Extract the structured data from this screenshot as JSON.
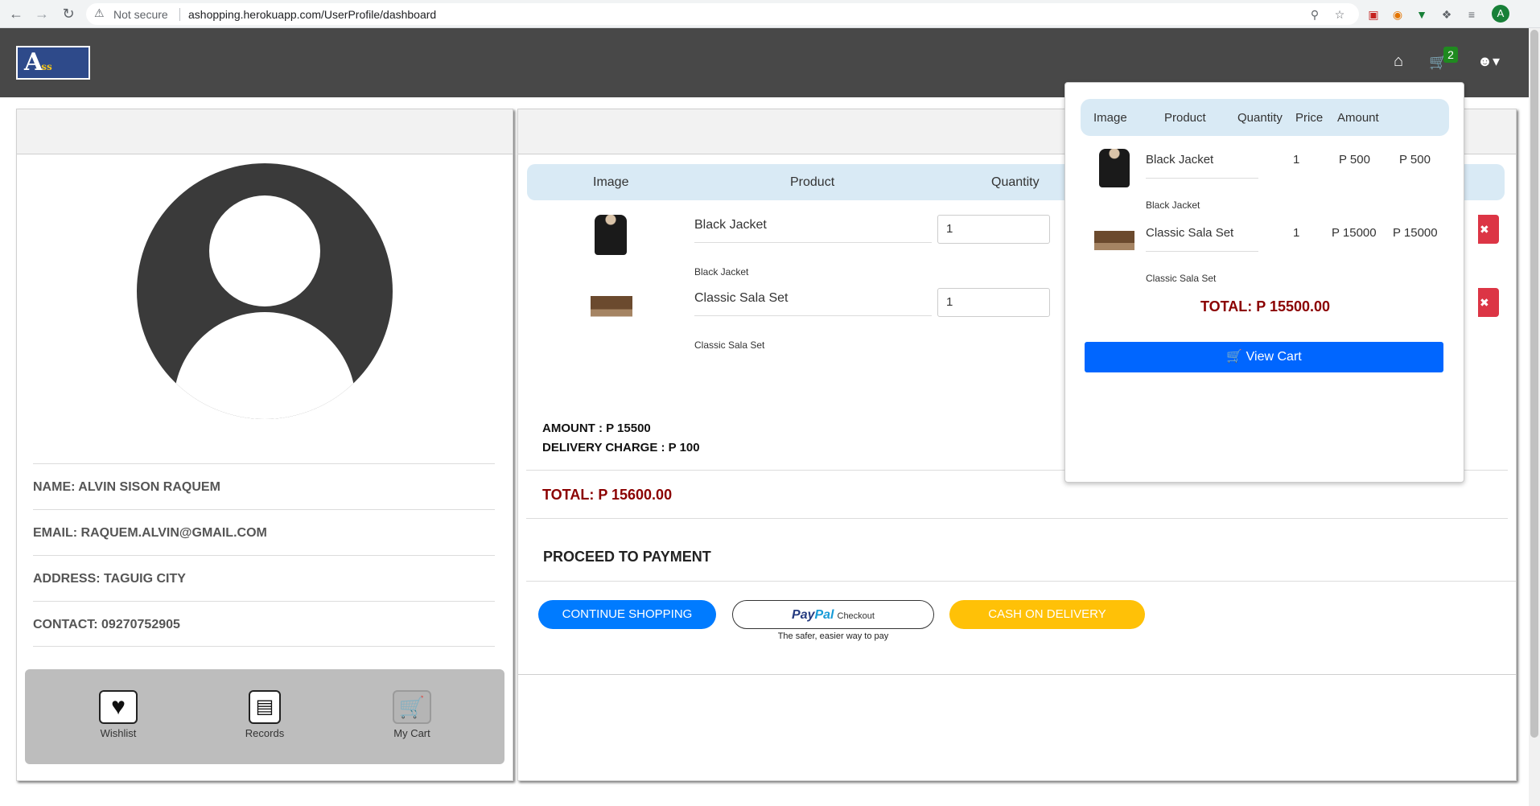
{
  "browser": {
    "security_label": "Not secure",
    "url": "ashopping.herokuapp.com/UserProfile/dashboard",
    "profile_initial": "A"
  },
  "header": {
    "logo_text": "A",
    "logo_sub": "ss",
    "cart_count": "2"
  },
  "profile": {
    "name": "NAME: ALVIN SISON RAQUEM",
    "email": "EMAIL: RAQUEM.ALVIN@GMAIL.COM",
    "address": "ADDRESS: TAGUIG CITY",
    "contact": "CONTACT: 09270752905",
    "actions": {
      "wishlist": "Wishlist",
      "records": "Records",
      "my_cart": "My Cart"
    }
  },
  "cart": {
    "columns": {
      "image": "Image",
      "product": "Product",
      "quantity": "Quantity"
    },
    "items": [
      {
        "name": "Black Jacket",
        "desc": "Black Jacket",
        "quantity": "1"
      },
      {
        "name": "Classic Sala Set",
        "desc": "Classic Sala Set",
        "quantity": "1"
      }
    ],
    "delete_icon": "✖",
    "amount": "AMOUNT : P 15500",
    "delivery": "DELIVERY CHARGE : P 100",
    "total": "TOTAL: P 15600.00",
    "proceed": "PROCEED TO PAYMENT",
    "buttons": {
      "continue": "CONTINUE SHOPPING",
      "paypal_a": "Pay",
      "paypal_b": "Pal",
      "paypal_checkout": "Checkout",
      "paypal_tagline": "The safer, easier way to pay",
      "cod": "CASH ON DELIVERY"
    }
  },
  "dropdown": {
    "columns": {
      "image": "Image",
      "product": "Product",
      "quantity": "Quantity",
      "price": "Price",
      "amount": "Amount"
    },
    "items": [
      {
        "name": "Black Jacket",
        "desc": "Black Jacket",
        "quantity": "1",
        "price": "P 500",
        "amount": "P 500"
      },
      {
        "name": "Classic Sala Set",
        "desc": "Classic Sala Set",
        "quantity": "1",
        "price": "P 15000",
        "amount": "P 15000"
      }
    ],
    "total": "TOTAL: P 15500.00",
    "view_cart": "View Cart"
  },
  "colors": {
    "header_bg": "#484848",
    "primary": "#007bff",
    "danger": "#dc3545",
    "warning": "#ffc107",
    "total_red": "#8b0000",
    "badge_green": "#1f8a1f"
  }
}
